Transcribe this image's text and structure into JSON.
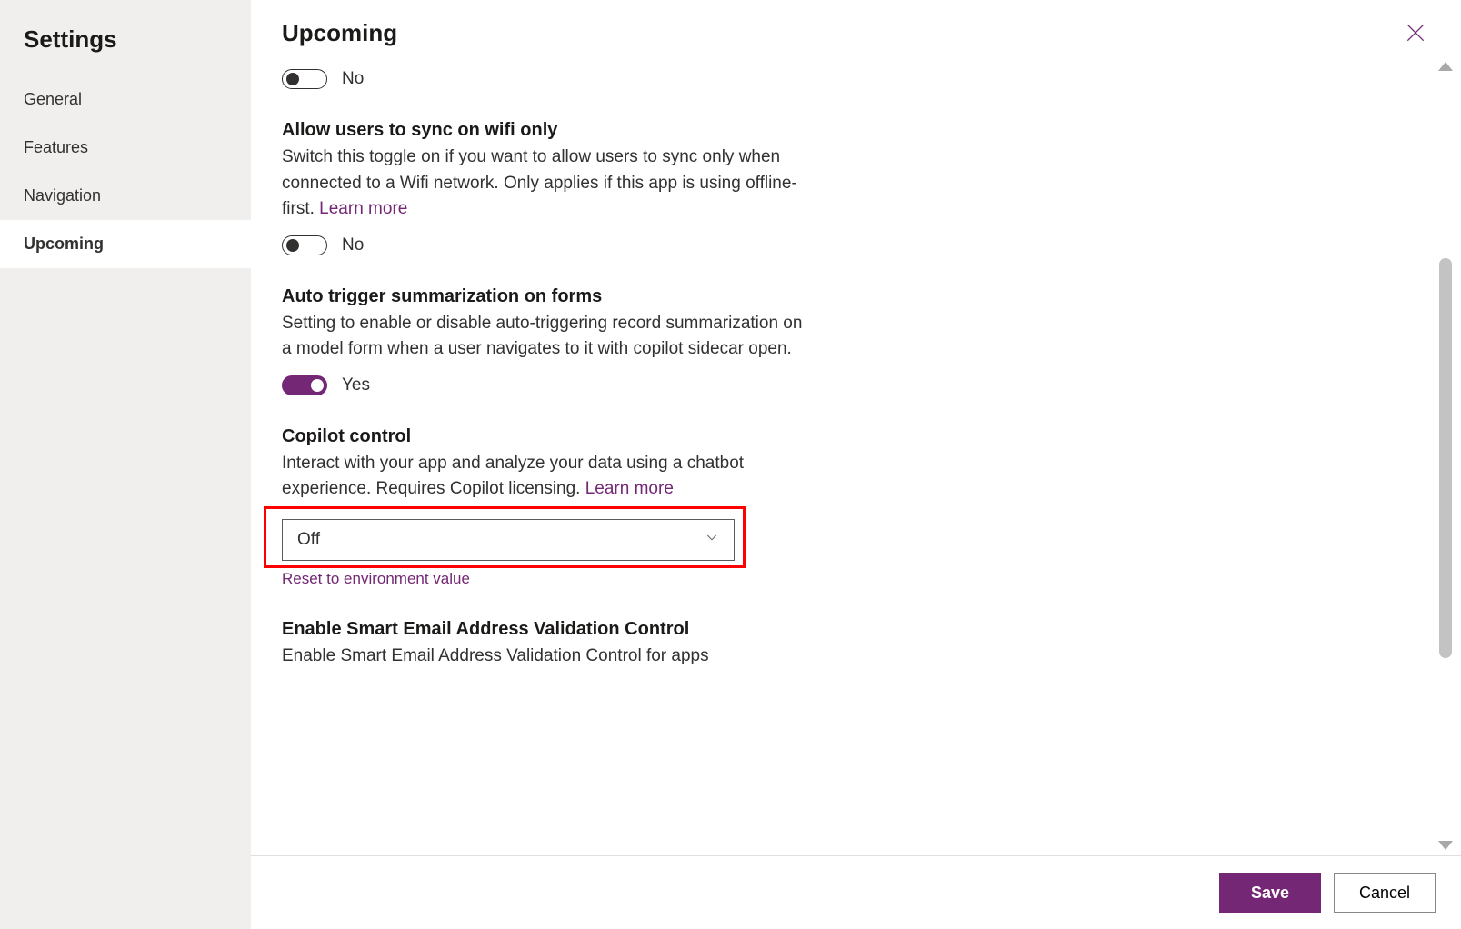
{
  "sidebar": {
    "title": "Settings",
    "items": [
      {
        "label": "General"
      },
      {
        "label": "Features"
      },
      {
        "label": "Navigation"
      },
      {
        "label": "Upcoming"
      }
    ],
    "activeIndex": 3
  },
  "header": {
    "title": "Upcoming"
  },
  "labels": {
    "yes": "Yes",
    "no": "No",
    "learnMore": "Learn more",
    "reset": "Reset to environment value"
  },
  "settings": [
    {
      "key": "orphan-toggle",
      "title": "",
      "desc": "",
      "type": "toggle",
      "value": false
    },
    {
      "key": "sync-wifi",
      "title": "Allow users to sync on wifi only",
      "desc": "Switch this toggle on if you want to allow users to sync only when connected to a Wifi network. Only applies if this app is using offline-first. ",
      "learnMore": true,
      "type": "toggle",
      "value": false
    },
    {
      "key": "auto-summarize",
      "title": "Auto trigger summarization on forms",
      "desc": "Setting to enable or disable auto-triggering record summarization on a model form when a user navigates to it with copilot sidecar open.",
      "learnMore": false,
      "type": "toggle",
      "value": true
    },
    {
      "key": "copilot-control",
      "title": "Copilot control",
      "desc": "Interact with your app and analyze your data using a chatbot experience. Requires Copilot licensing. ",
      "learnMore": true,
      "type": "select",
      "selected": "Off",
      "highlight": true,
      "resetLink": true
    },
    {
      "key": "smart-email",
      "title": "Enable Smart Email Address Validation Control",
      "desc": "Enable Smart Email Address Validation Control for apps",
      "learnMore": false,
      "type": "toggle",
      "value": false,
      "hideToggle": true
    }
  ],
  "footer": {
    "save": "Save",
    "cancel": "Cancel"
  }
}
